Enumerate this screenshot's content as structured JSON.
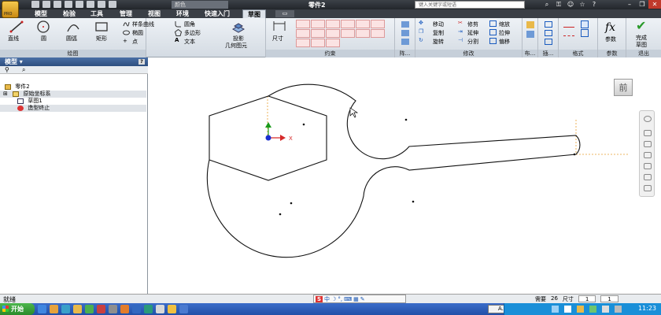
{
  "titlebar": {
    "app_badge": "PRO",
    "style_dropdown": "颜色",
    "doc_title": "零件2",
    "search_placeholder": "键入关键字或短语"
  },
  "tabs": [
    {
      "label": "模型"
    },
    {
      "label": "检验"
    },
    {
      "label": "工具"
    },
    {
      "label": "管理"
    },
    {
      "label": "视图"
    },
    {
      "label": "环境"
    },
    {
      "label": "快速入门"
    },
    {
      "label": "草图",
      "active": true
    }
  ],
  "ribbon": {
    "draw": {
      "line": "直线",
      "circle": "圆",
      "arc": "圆弧",
      "rect": "矩形",
      "spline": "样条曲线",
      "ellipse": "椭圆",
      "point": "点",
      "fillet": "圆角",
      "polygon": "多边形",
      "text": "文本",
      "project_line1": "投影",
      "project_line2": "几何图元",
      "group_label": "绘图"
    },
    "constrain": {
      "dimension": "尺寸",
      "group_label": "约束"
    },
    "pattern": {
      "group_label": "阵..."
    },
    "modify": {
      "move": "移动",
      "trim": "修剪",
      "scale": "缩放",
      "copy": "复制",
      "extend": "延伸",
      "stretch": "拉伸",
      "rotate": "旋转",
      "split": "分割",
      "offset": "偏移",
      "group_label": "修改"
    },
    "layout": {
      "group_label": "布..."
    },
    "insert": {
      "group_label": "插..."
    },
    "format": {
      "group_label": "格式"
    },
    "params": {
      "label": "参数",
      "group_label": "参数"
    },
    "exit": {
      "line1": "完成",
      "line2": "草图",
      "group_label": "退出"
    }
  },
  "panel": {
    "header": "模型",
    "help": "?",
    "tree": [
      {
        "label": "零件2"
      },
      {
        "label": "原始坐标系"
      },
      {
        "label": "草图1"
      },
      {
        "label": "造型终止"
      }
    ]
  },
  "canvas": {
    "viewcube_label": "前",
    "axis_x": "X",
    "axis_y": "Y"
  },
  "status": {
    "text": "就绪",
    "needed_label": "需要",
    "needed_value": "26",
    "dim_label": "尺寸",
    "page_a": "1",
    "page_b": "1"
  },
  "taskbar": {
    "start": "开始",
    "ime_lang": "A...",
    "clock": "11:23"
  },
  "colors": {
    "accent": "#2e4f80",
    "taskbar": "#2150a8",
    "axis_x": "#d62a2a",
    "axis_y": "#1a9a1a",
    "origin": "#1a2fd0",
    "sketch_line": "#111111",
    "dashed": "#e8a030"
  }
}
